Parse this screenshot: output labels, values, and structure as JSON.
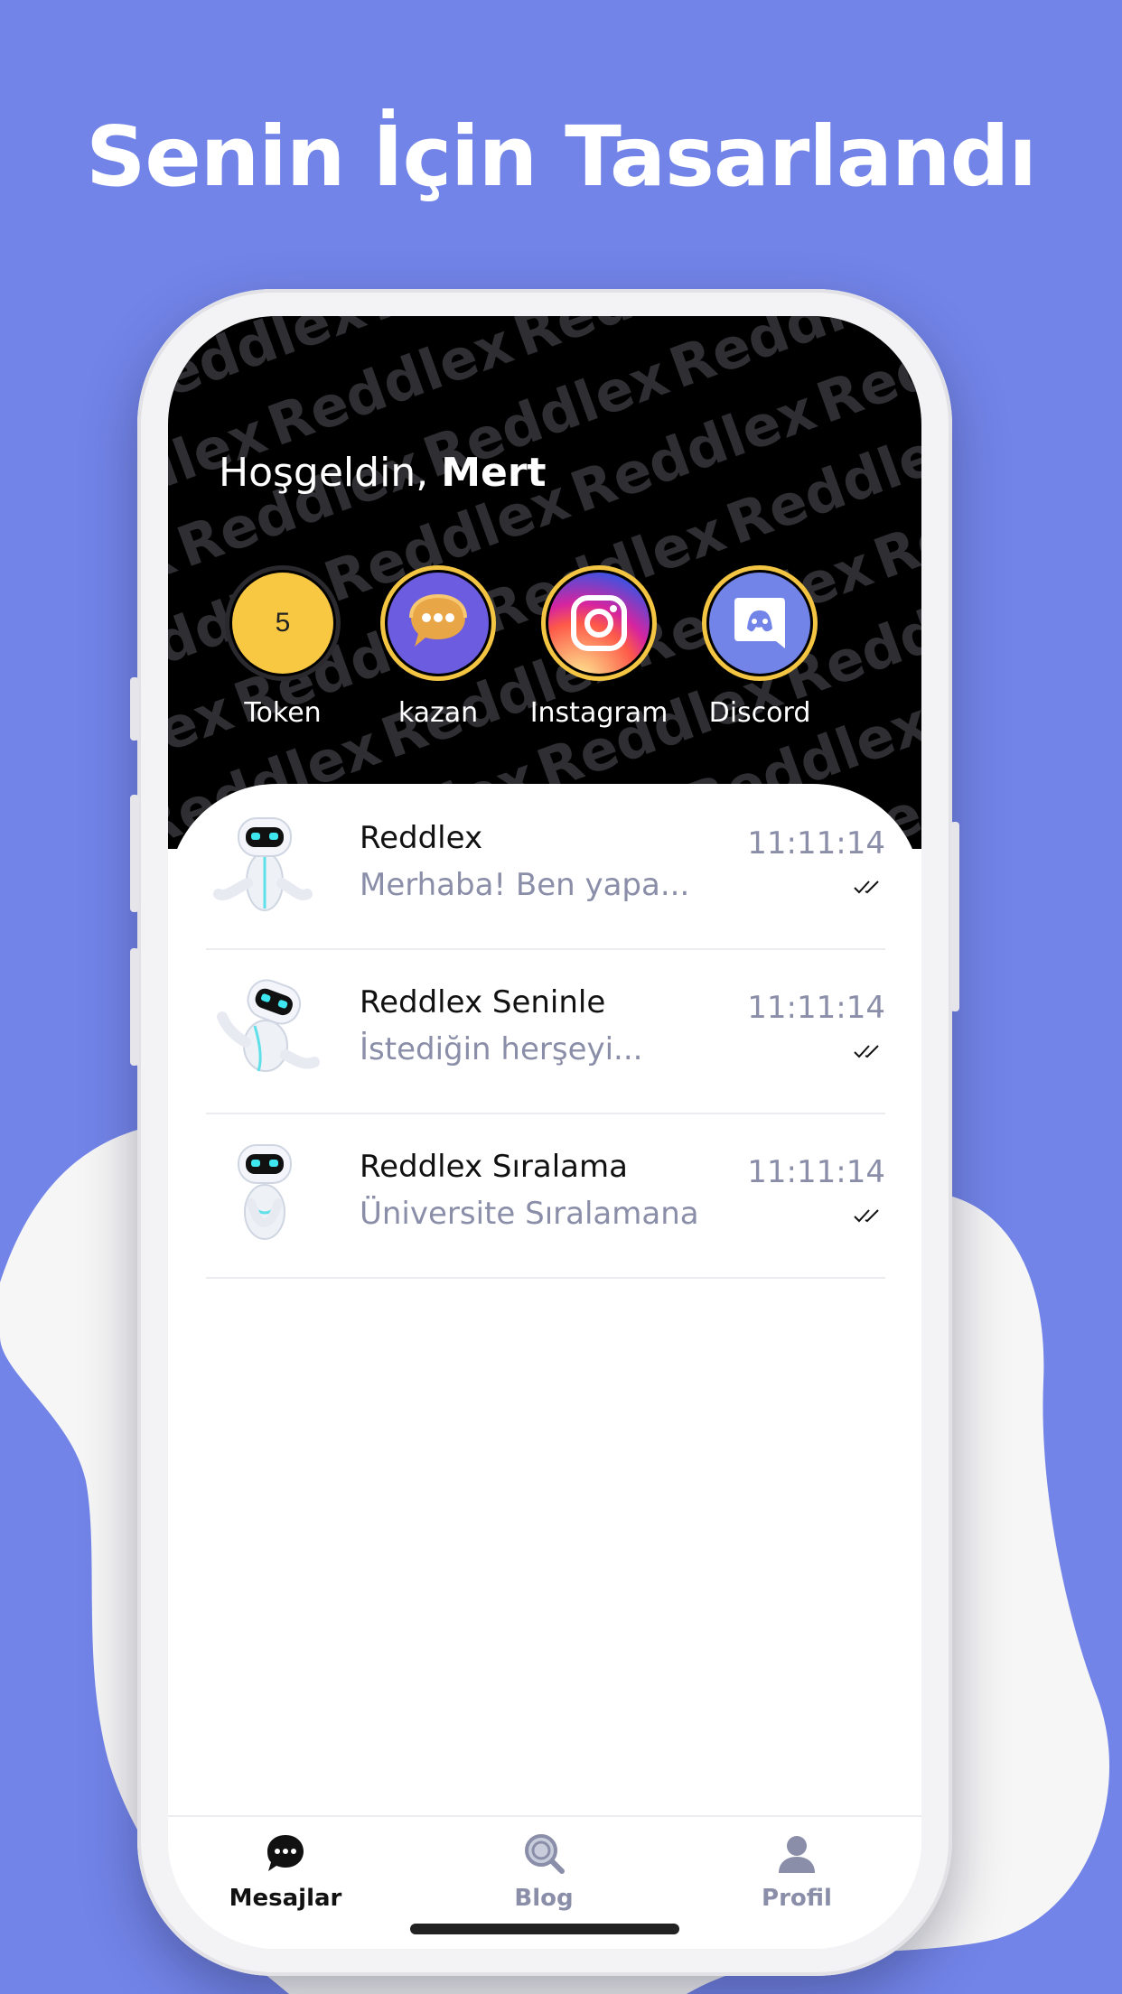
{
  "promo": {
    "title": "Senin İçin Tasarlandı"
  },
  "header": {
    "greeting_prefix": "Hoşgeldin,",
    "username": "Mert",
    "watermark_word": "Reddlex"
  },
  "stories": [
    {
      "label": "Token",
      "value": "5",
      "icon": "token-coin-icon"
    },
    {
      "label": "kazan",
      "icon": "chat-bubble-icon"
    },
    {
      "label": "Instagram",
      "icon": "instagram-icon"
    },
    {
      "label": "Discord",
      "icon": "discord-icon"
    }
  ],
  "chats": [
    {
      "name": "Reddlex",
      "preview": "Merhaba! Ben yapa...",
      "time": "11:11:14"
    },
    {
      "name": "Reddlex Seninle",
      "preview": "İstediğin herşeyi...",
      "time": "11:11:14"
    },
    {
      "name": "Reddlex Sıralama",
      "preview": "Üniversite Sıralamana",
      "time": "11:11:14"
    }
  ],
  "tabbar": {
    "items": [
      {
        "label": "Mesajlar",
        "icon": "message-icon",
        "active": true
      },
      {
        "label": "Blog",
        "icon": "search-icon",
        "active": false
      },
      {
        "label": "Profil",
        "icon": "user-icon",
        "active": false
      }
    ]
  },
  "colors": {
    "background": "#7284E8",
    "accent_ring": "#F4C542",
    "muted_text": "#8a8ea8"
  }
}
